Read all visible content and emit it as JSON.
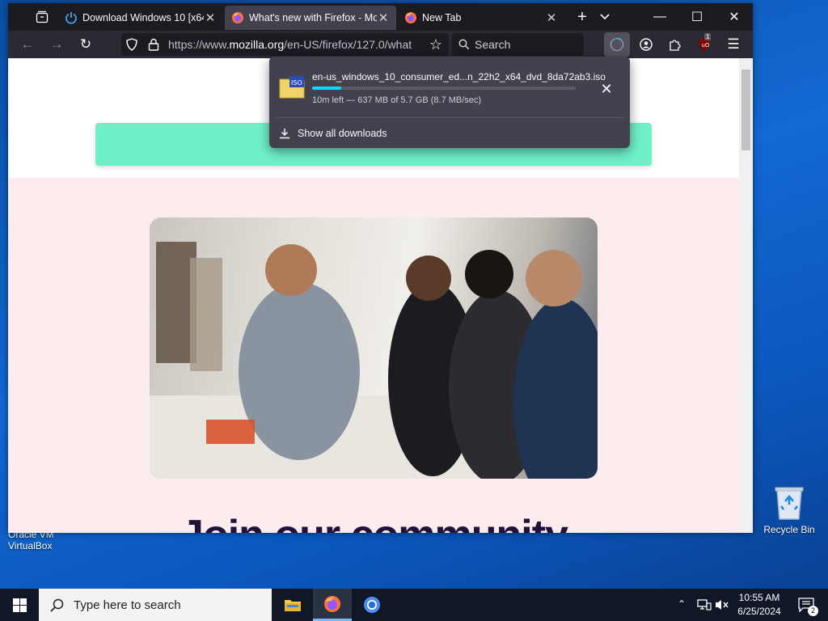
{
  "browser": {
    "tabs": [
      {
        "title": "Download Windows 10 [x64/"
      },
      {
        "title": "What's new with Firefox - Mo"
      },
      {
        "title": "New Tab"
      }
    ],
    "url": {
      "prefix": "https://www.",
      "domain": "mozilla.org",
      "path": "/en-US/firefox/127.0/what"
    },
    "search_placeholder": "Search",
    "extension_badge": "1"
  },
  "downloads": {
    "filename": "en-us_windows_10_consumer_ed...n_22h2_x64_dvd_8da72ab3.iso",
    "file_icon_label": "ISO",
    "status": "10m left — 637 MB of 5.7 GB (8.7 MB/sec)",
    "progress_fraction": 0.11,
    "show_all_label": "Show all downloads"
  },
  "page": {
    "heading": "Join our community",
    "banner_color": "#6ff0c8"
  },
  "desktop": {
    "recycle_bin_label": "Recycle Bin",
    "vbox_label_line1": "Oracle VM",
    "vbox_label_line2": "VirtualBox"
  },
  "taskbar": {
    "search_placeholder": "Type here to search",
    "time": "10:55 AM",
    "date": "6/25/2024",
    "notification_count": "2"
  },
  "colors": {
    "accent": "#00ddff",
    "tab_active": "#42414d",
    "toolbar": "#2b2a33"
  }
}
